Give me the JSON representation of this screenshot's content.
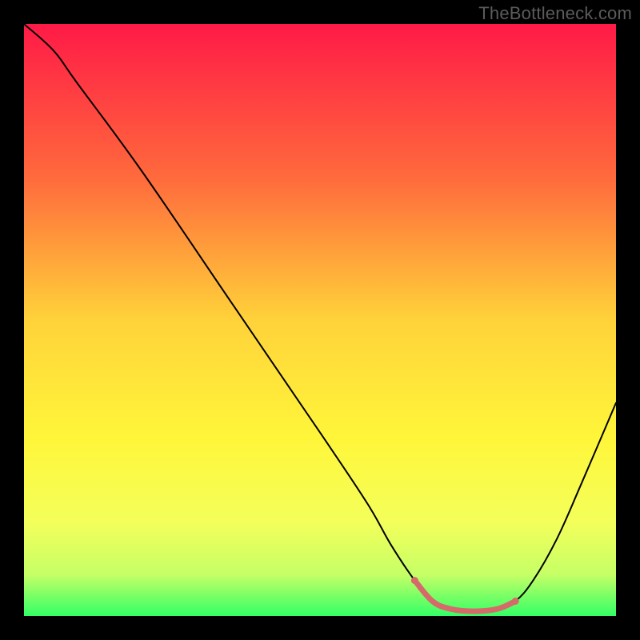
{
  "watermark": "TheBottleneck.com",
  "chart_data": {
    "type": "line",
    "title": "",
    "xlabel": "",
    "ylabel": "",
    "xlim": [
      0,
      100
    ],
    "ylim": [
      0,
      100
    ],
    "gradient_stops": [
      {
        "offset": 0,
        "color": "#ff1a47"
      },
      {
        "offset": 26,
        "color": "#ff6a3c"
      },
      {
        "offset": 50,
        "color": "#ffd23a"
      },
      {
        "offset": 70,
        "color": "#fff63a"
      },
      {
        "offset": 84,
        "color": "#f4ff5a"
      },
      {
        "offset": 93,
        "color": "#c6ff66"
      },
      {
        "offset": 100,
        "color": "#33ff66"
      }
    ],
    "series": [
      {
        "name": "bottleneck-curve",
        "color": "#000000",
        "width": 2.0,
        "points": [
          {
            "x": 0,
            "y": 100
          },
          {
            "x": 5,
            "y": 95.5
          },
          {
            "x": 9,
            "y": 90
          },
          {
            "x": 20,
            "y": 75
          },
          {
            "x": 35,
            "y": 53
          },
          {
            "x": 50,
            "y": 31
          },
          {
            "x": 58,
            "y": 19
          },
          {
            "x": 62,
            "y": 12
          },
          {
            "x": 66,
            "y": 6
          },
          {
            "x": 69,
            "y": 2.5
          },
          {
            "x": 72,
            "y": 1.2
          },
          {
            "x": 76,
            "y": 0.8
          },
          {
            "x": 80,
            "y": 1.2
          },
          {
            "x": 83,
            "y": 2.5
          },
          {
            "x": 86,
            "y": 6
          },
          {
            "x": 90,
            "y": 13
          },
          {
            "x": 94,
            "y": 22
          },
          {
            "x": 100,
            "y": 36
          }
        ]
      },
      {
        "name": "highlight-band",
        "color": "#d66a6a",
        "width": 7,
        "points": [
          {
            "x": 66,
            "y": 6
          },
          {
            "x": 69,
            "y": 2.5
          },
          {
            "x": 72,
            "y": 1.2
          },
          {
            "x": 76,
            "y": 0.8
          },
          {
            "x": 80,
            "y": 1.2
          },
          {
            "x": 83,
            "y": 2.5
          }
        ],
        "endpoint_dots": [
          {
            "x": 66,
            "y": 6
          },
          {
            "x": 83,
            "y": 2.5
          }
        ]
      }
    ]
  }
}
